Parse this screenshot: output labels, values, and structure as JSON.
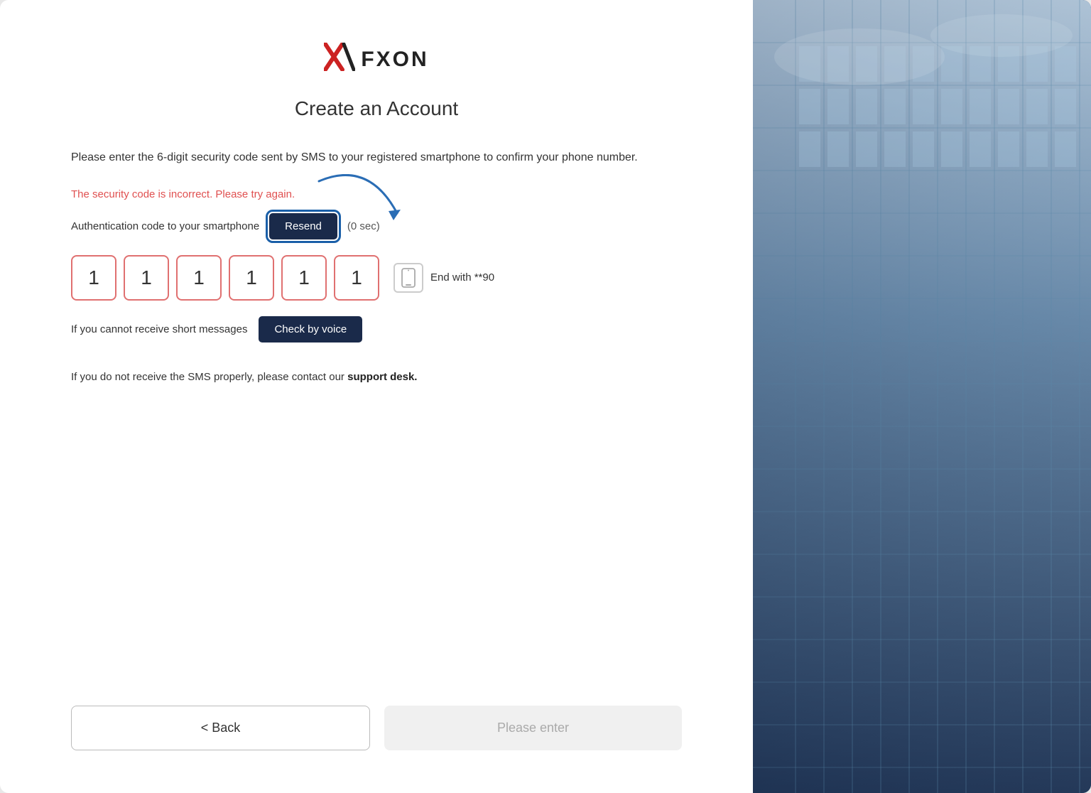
{
  "logo": {
    "x_symbol": "✕",
    "brand_name": "FXON"
  },
  "page": {
    "title": "Create an Account"
  },
  "form": {
    "description": "Please enter the 6-digit security code sent by SMS to your registered smartphone to confirm your phone number.",
    "error_message": "The security code is incorrect. Please try again.",
    "auth_label": "Authentication code to your smartphone",
    "resend_button": "Resend",
    "timer": "(0 sec)",
    "otp_digits": [
      "1",
      "1",
      "1",
      "1",
      "1",
      "1"
    ],
    "phone_end": "End with **90",
    "voice_label": "If you cannot receive short messages",
    "voice_button": "Check by voice",
    "support_text_prefix": "If you do not receive the SMS properly, please contact our ",
    "support_link": "support desk.",
    "back_button": "< Back",
    "submit_button": "Please enter"
  }
}
